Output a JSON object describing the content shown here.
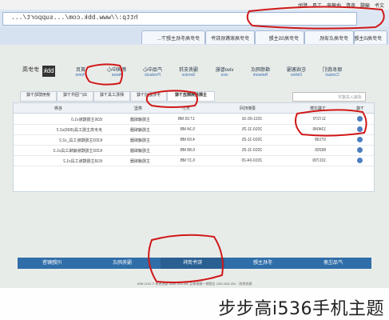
{
  "browser": {
    "address": "http://www.bbk.com/...support/...",
    "menu": [
      "文件",
      "编辑",
      "查看",
      "收藏夹",
      "工具",
      "帮助"
    ],
    "tabs": [
      "步步高手机主题下...",
      "步步高家教机软件",
      "步步高S5主题",
      "步步高点读机",
      "步步高i5主题"
    ]
  },
  "site": {
    "logo_mark": "bbk",
    "logo_text": "步步高",
    "nav": [
      {
        "cn": "首页",
        "en": "Home"
      },
      {
        "cn": "新闻中心",
        "en": "News"
      },
      {
        "cn": "产品中心",
        "en": "Products"
      },
      {
        "cn": "服务支持",
        "en": "Service"
      },
      {
        "cn": "vivo智能",
        "en": "vivo"
      },
      {
        "cn": "维修网点",
        "en": "Network"
      },
      {
        "cn": "在线客服",
        "en": "Online"
      },
      {
        "cn": "联系我们",
        "en": "Contact"
      }
    ],
    "subtabs": [
      "主题视频精选下载",
      "手机驱动下载",
      "刷机工具下载",
      "出厂固件下载",
      "使用帮助下载"
    ],
    "table": {
      "headers": [
        "名称",
        "类型",
        "大小",
        "更新时间",
        "下载次数",
        "下载"
      ],
      "search_placeholder": "请输入关键字",
      "rows": [
        [
          "i536主题模板v1.0",
          "主题编辑器",
          "17.03 MB",
          "2011-05-16",
          "117270"
        ],
        [
          "步步高主题工具(i506)v2.2",
          "主题编辑器",
          "5.34 MB",
          "2010-11-25",
          "134045"
        ],
        [
          "K203主题模板工具_v2.2",
          "主题编辑器",
          "4.69 MB",
          "2010-11-25",
          "97198"
        ],
        [
          "K202主题模板编辑工具v1.3",
          "主题编辑器",
          "6.88 MB",
          "2010-11-25",
          "89265"
        ],
        [
          "i518主题模板工具v1.2",
          "主题编辑器",
          "6.37 MB",
          "2010-04-20",
          "101709"
        ]
      ]
    },
    "bottom_links": [
      "问题解答",
      "服务网点",
      "软件资料",
      "手机主题",
      "产品注册"
    ],
    "footer": "服务热线：400-828-0001   全国统一客服电话   400-616-6688   版权所有 © 2011 BBK",
    "caption": "步步高i536手机主题"
  },
  "colors": {
    "annotation": "#d01818",
    "bottombar": "#2f6ea8",
    "page_bg": "#e8ece9"
  }
}
